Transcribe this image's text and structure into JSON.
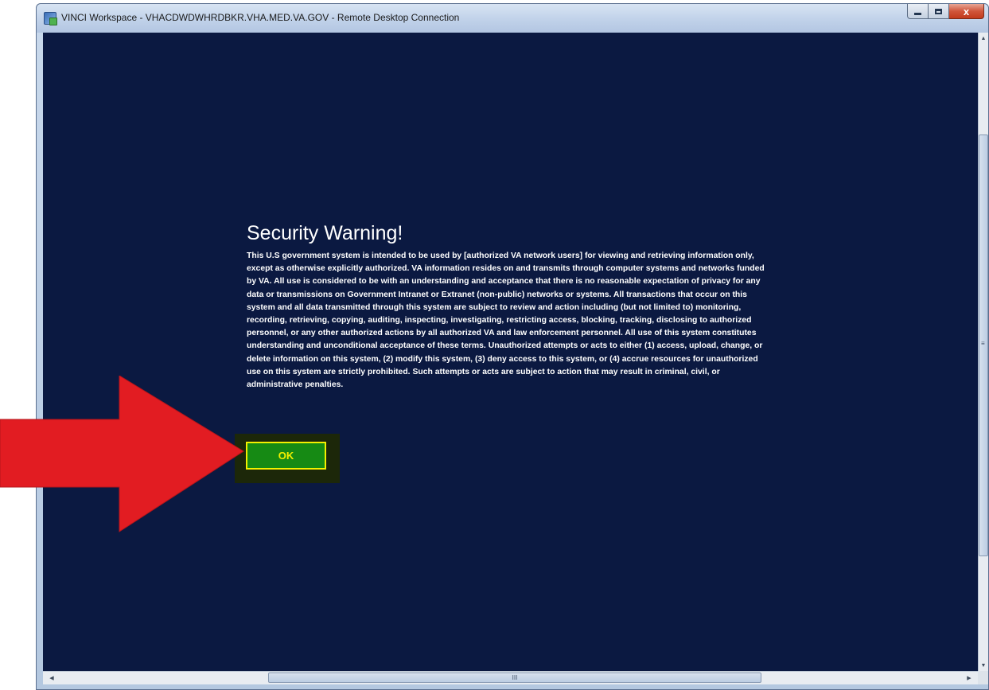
{
  "window": {
    "title": "VINCI Workspace - VHACDWDWHRDBKR.VHA.MED.VA.GOV - Remote Desktop Connection",
    "controls": {
      "minimize_icon": "minimize-icon",
      "maximize_icon": "maximize-icon",
      "close_glyph": "x"
    }
  },
  "warning": {
    "title": "Security Warning!",
    "body": "This U.S government system is intended to be used by [authorized VA network users] for viewing and retrieving information only, except as otherwise explicitly authorized. VA information resides on and transmits through computer systems and networks funded by VA. All use is considered to be with an understanding and acceptance that there is no reasonable expectation of privacy for any data or transmissions on Government Intranet or Extranet (non-public) networks or systems. All transactions that occur on this system and all data transmitted through this system are subject to review and action including (but not limited to) monitoring, recording, retrieving, copying, auditing, inspecting, investigating, restricting access, blocking, tracking, disclosing to authorized personnel, or any other authorized actions by all authorized VA and law enforcement personnel. All use of this system constitutes understanding and unconditional acceptance of these terms. Unauthorized attempts or acts to either (1) access, upload, change, or delete information on this system, (2) modify this system, (3) deny access to this system, or (4) accrue resources for unauthorized use on this system are strictly prohibited. Such attempts or acts are subject to action that may result in criminal, civil, or administrative penalties.",
    "ok_label": "OK"
  },
  "scrollbars": {
    "vertical_grip": "≡",
    "horizontal_grip": "III"
  },
  "colors": {
    "desktop_background": "#0b1941",
    "ok_button": "#168a14",
    "ok_border_text": "#f3f000",
    "annotation_arrow": "#e21c22"
  },
  "icons": [
    "remote-desktop-icon",
    "minimize-icon",
    "maximize-icon",
    "close-icon",
    "red-arrow-annotation"
  ]
}
